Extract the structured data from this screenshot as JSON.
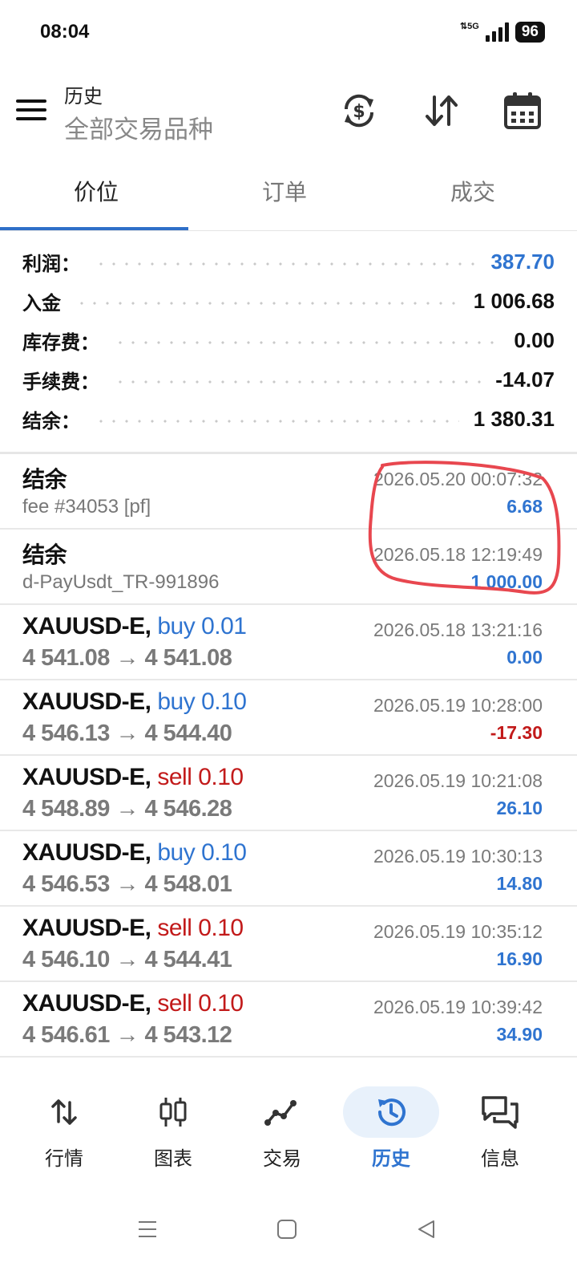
{
  "status_bar": {
    "time": "08:04",
    "network": "5G",
    "battery": "96"
  },
  "header": {
    "title": "历史",
    "subtitle": "全部交易品种",
    "icons": [
      "menu-icon",
      "currency-exchange-icon",
      "sort-icon",
      "calendar-icon"
    ]
  },
  "tabs": [
    {
      "label": "价位",
      "active": true
    },
    {
      "label": "订单",
      "active": false
    },
    {
      "label": "成交",
      "active": false
    }
  ],
  "summary": {
    "profit": {
      "label": "利润：",
      "value": "387.70"
    },
    "deposit": {
      "label": "入金",
      "value": "1 006.68"
    },
    "swap": {
      "label": "库存费：",
      "value": "0.00"
    },
    "commission": {
      "label": "手续费：",
      "value": "-14.07"
    },
    "balance": {
      "label": "结余：",
      "value": "1 380.31"
    }
  },
  "entries": [
    {
      "title": "结余",
      "subtitle": "fee #34053 [pf]",
      "time": "2026.05.20 00:07:32",
      "amount": "6.68"
    },
    {
      "title": "结余",
      "subtitle": "d-PayUsdt_TR-991896",
      "time": "2026.05.18 12:19:49",
      "amount": "1 000.00"
    }
  ],
  "trades": [
    {
      "symbol": "XAUUSD-E,",
      "direction": "buy 0.01",
      "prices": "4 541.08 → 4 541.08",
      "time": "2026.05.18 13:21:16",
      "profit": "0.00"
    },
    {
      "symbol": "XAUUSD-E,",
      "direction": "buy 0.10",
      "prices": "4 546.13 → 4 544.40",
      "time": "2026.05.19 10:28:00",
      "profit": "-17.30"
    },
    {
      "symbol": "XAUUSD-E,",
      "direction": "sell 0.10",
      "prices": "4 548.89 → 4 546.28",
      "time": "2026.05.19 10:21:08",
      "profit": "26.10"
    },
    {
      "symbol": "XAUUSD-E,",
      "direction": "buy 0.10",
      "prices": "4 546.53 → 4 548.01",
      "time": "2026.05.19 10:30:13",
      "profit": "14.80"
    },
    {
      "symbol": "XAUUSD-E,",
      "direction": "sell 0.10",
      "prices": "4 546.10 → 4 544.41",
      "time": "2026.05.19 10:35:12",
      "profit": "16.90"
    },
    {
      "symbol": "XAUUSD-E,",
      "direction": "sell 0.10",
      "prices": "4 546.61 → 4 543.12",
      "time": "2026.05.19 10:39:42",
      "profit": "34.90"
    }
  ],
  "bottom_nav": [
    {
      "label": "行情",
      "icon": "quotes-icon",
      "active": false
    },
    {
      "label": "图表",
      "icon": "chart-icon",
      "active": false
    },
    {
      "label": "交易",
      "icon": "trade-icon",
      "active": false
    },
    {
      "label": "历史",
      "icon": "history-icon",
      "active": true
    },
    {
      "label": "信息",
      "icon": "messages-icon",
      "active": false
    }
  ],
  "colors": {
    "accent_blue": "#2f74d0",
    "loss_red": "#c21a1a",
    "annotation_red": "#e8474f",
    "active_nav_bg": "#e8f1fb"
  }
}
